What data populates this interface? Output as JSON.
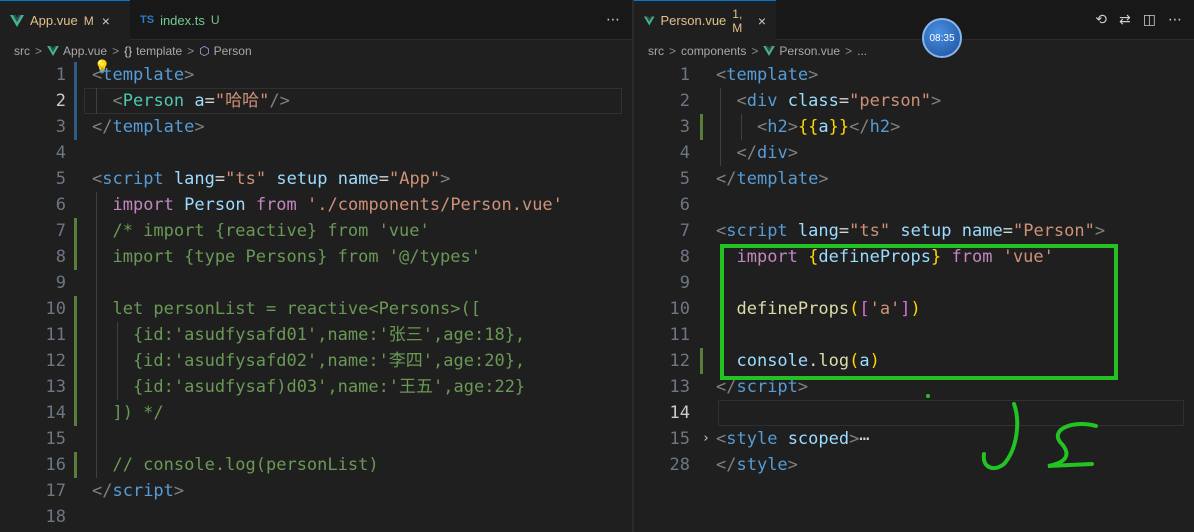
{
  "left": {
    "tabs": [
      {
        "name": "App.vue",
        "state": "M",
        "close": "×"
      },
      {
        "name": "index.ts",
        "state": "U",
        "logo": "TS"
      }
    ],
    "more_icon": "⋯",
    "breadcrumb": [
      "src",
      "App.vue",
      "template",
      "Person"
    ],
    "lines": [
      {
        "n": "1",
        "tokens": [
          [
            "t-punc",
            "<"
          ],
          [
            "t-tag",
            "template"
          ],
          [
            "t-punc",
            ">"
          ]
        ]
      },
      {
        "n": "2",
        "tokens": [
          [
            "t-plain",
            "  "
          ],
          [
            "t-punc",
            "<"
          ],
          [
            "t-comp",
            "Person"
          ],
          [
            "t-plain",
            " "
          ],
          [
            "t-attr",
            "a"
          ],
          [
            "t-plain",
            "="
          ],
          [
            "t-str",
            "\"哈哈\""
          ],
          [
            "t-punc",
            "/>"
          ]
        ]
      },
      {
        "n": "3",
        "tokens": [
          [
            "t-punc",
            "</"
          ],
          [
            "t-tag",
            "template"
          ],
          [
            "t-punc",
            ">"
          ]
        ]
      },
      {
        "n": "4",
        "tokens": []
      },
      {
        "n": "5",
        "tokens": [
          [
            "t-punc",
            "<"
          ],
          [
            "t-tag",
            "script"
          ],
          [
            "t-plain",
            " "
          ],
          [
            "t-attr",
            "lang"
          ],
          [
            "t-plain",
            "="
          ],
          [
            "t-str",
            "\"ts\""
          ],
          [
            "t-plain",
            " "
          ],
          [
            "t-attr",
            "setup"
          ],
          [
            "t-plain",
            " "
          ],
          [
            "t-attr",
            "name"
          ],
          [
            "t-plain",
            "="
          ],
          [
            "t-str",
            "\"App\""
          ],
          [
            "t-punc",
            ">"
          ]
        ]
      },
      {
        "n": "6",
        "tokens": [
          [
            "t-plain",
            "  "
          ],
          [
            "t-kw",
            "import"
          ],
          [
            "t-plain",
            " "
          ],
          [
            "t-var",
            "Person"
          ],
          [
            "t-plain",
            " "
          ],
          [
            "t-kw",
            "from"
          ],
          [
            "t-plain",
            " "
          ],
          [
            "t-str",
            "'./components/Person.vue'"
          ]
        ]
      },
      {
        "n": "7",
        "tokens": [
          [
            "t-com",
            "  /* import {reactive} from 'vue'"
          ]
        ]
      },
      {
        "n": "8",
        "tokens": [
          [
            "t-com",
            "  import {type Persons} from '@/types'"
          ]
        ]
      },
      {
        "n": "9",
        "tokens": []
      },
      {
        "n": "10",
        "tokens": [
          [
            "t-com",
            "  let personList = reactive<Persons>(["
          ]
        ]
      },
      {
        "n": "11",
        "tokens": [
          [
            "t-com",
            "    {id:'asudfysafd01',name:'张三',age:18},"
          ]
        ]
      },
      {
        "n": "12",
        "tokens": [
          [
            "t-com",
            "    {id:'asudfysafd02',name:'李四',age:20},"
          ]
        ]
      },
      {
        "n": "13",
        "tokens": [
          [
            "t-com",
            "    {id:'asudfysaf)d03',name:'王五',age:22}"
          ]
        ]
      },
      {
        "n": "14",
        "tokens": [
          [
            "t-com",
            "  ]) */"
          ]
        ]
      },
      {
        "n": "15",
        "tokens": []
      },
      {
        "n": "16",
        "tokens": [
          [
            "t-com",
            "  // console.log(personList)"
          ]
        ]
      },
      {
        "n": "17",
        "tokens": [
          [
            "t-punc",
            "</"
          ],
          [
            "t-tag",
            "script"
          ],
          [
            "t-punc",
            ">"
          ]
        ]
      },
      {
        "n": "18",
        "tokens": []
      }
    ]
  },
  "right": {
    "tabs": [
      {
        "name": "Person.vue",
        "state": "1, M",
        "close": "×"
      }
    ],
    "actions": [
      "⟲",
      "⇄",
      "◫",
      "⋯"
    ],
    "clock": "08:35",
    "breadcrumb": [
      "src",
      "components",
      "Person.vue",
      "..."
    ],
    "lines": [
      {
        "n": "1",
        "tokens": [
          [
            "t-punc",
            "<"
          ],
          [
            "t-tag",
            "template"
          ],
          [
            "t-punc",
            ">"
          ]
        ]
      },
      {
        "n": "2",
        "tokens": [
          [
            "t-plain",
            "  "
          ],
          [
            "t-punc",
            "<"
          ],
          [
            "t-tag",
            "div"
          ],
          [
            "t-plain",
            " "
          ],
          [
            "t-attr",
            "class"
          ],
          [
            "t-plain",
            "="
          ],
          [
            "t-str",
            "\"person\""
          ],
          [
            "t-punc",
            ">"
          ]
        ]
      },
      {
        "n": "3",
        "tokens": [
          [
            "t-plain",
            "    "
          ],
          [
            "t-punc",
            "<"
          ],
          [
            "t-tag",
            "h2"
          ],
          [
            "t-punc",
            ">"
          ],
          [
            "t-brace",
            "{{"
          ],
          [
            "t-var",
            "a"
          ],
          [
            "t-brace",
            "}}"
          ],
          [
            "t-punc",
            "</"
          ],
          [
            "t-tag",
            "h2"
          ],
          [
            "t-punc",
            ">"
          ]
        ]
      },
      {
        "n": "4",
        "tokens": [
          [
            "t-plain",
            "  "
          ],
          [
            "t-punc",
            "</"
          ],
          [
            "t-tag",
            "div"
          ],
          [
            "t-punc",
            ">"
          ]
        ]
      },
      {
        "n": "5",
        "tokens": [
          [
            "t-punc",
            "</"
          ],
          [
            "t-tag",
            "template"
          ],
          [
            "t-punc",
            ">"
          ]
        ]
      },
      {
        "n": "6",
        "tokens": []
      },
      {
        "n": "7",
        "tokens": [
          [
            "t-punc",
            "<"
          ],
          [
            "t-tag",
            "script"
          ],
          [
            "t-plain",
            " "
          ],
          [
            "t-attr",
            "lang"
          ],
          [
            "t-plain",
            "="
          ],
          [
            "t-str",
            "\"ts\""
          ],
          [
            "t-plain",
            " "
          ],
          [
            "t-attr",
            "setup"
          ],
          [
            "t-plain",
            " "
          ],
          [
            "t-attr",
            "name"
          ],
          [
            "t-plain",
            "="
          ],
          [
            "t-str",
            "\"Person\""
          ],
          [
            "t-punc",
            ">"
          ]
        ]
      },
      {
        "n": "8",
        "tokens": [
          [
            "t-plain",
            "  "
          ],
          [
            "t-kw",
            "import"
          ],
          [
            "t-plain",
            " "
          ],
          [
            "t-brace",
            "{"
          ],
          [
            "t-var",
            "defineProps"
          ],
          [
            "t-brace",
            "}"
          ],
          [
            "t-plain",
            " "
          ],
          [
            "t-kw",
            "from"
          ],
          [
            "t-plain",
            " "
          ],
          [
            "t-str",
            "'vue'"
          ]
        ]
      },
      {
        "n": "9",
        "tokens": []
      },
      {
        "n": "10",
        "tokens": [
          [
            "t-plain",
            "  "
          ],
          [
            "t-fn",
            "defineProps"
          ],
          [
            "t-brace",
            "("
          ],
          [
            "t-paren",
            "["
          ],
          [
            "t-str",
            "'a'"
          ],
          [
            "t-paren",
            "]"
          ],
          [
            "t-brace",
            ")"
          ]
        ]
      },
      {
        "n": "11",
        "tokens": []
      },
      {
        "n": "12",
        "tokens": [
          [
            "t-plain",
            "  "
          ],
          [
            "t-var",
            "console"
          ],
          [
            "t-plain",
            "."
          ],
          [
            "t-fn",
            "log"
          ],
          [
            "t-brace",
            "("
          ],
          [
            "t-var",
            "a"
          ],
          [
            "t-brace",
            ")"
          ]
        ]
      },
      {
        "n": "13",
        "tokens": [
          [
            "t-punc",
            "</"
          ],
          [
            "t-tag",
            "script"
          ],
          [
            "t-punc",
            ">"
          ]
        ]
      },
      {
        "n": "14",
        "tokens": []
      },
      {
        "n": "15",
        "tokens": [
          [
            "t-punc",
            "<"
          ],
          [
            "t-tag",
            "style"
          ],
          [
            "t-plain",
            " "
          ],
          [
            "t-attr",
            "scoped"
          ],
          [
            "t-punc",
            ">"
          ],
          [
            "t-plain",
            "⋯"
          ]
        ]
      },
      {
        "n": "28",
        "tokens": [
          [
            "t-punc",
            "</"
          ],
          [
            "t-tag",
            "style"
          ],
          [
            "t-punc",
            ">"
          ]
        ]
      }
    ]
  },
  "colors": {
    "annotation": "#22c322",
    "accent": "#0078d4"
  }
}
